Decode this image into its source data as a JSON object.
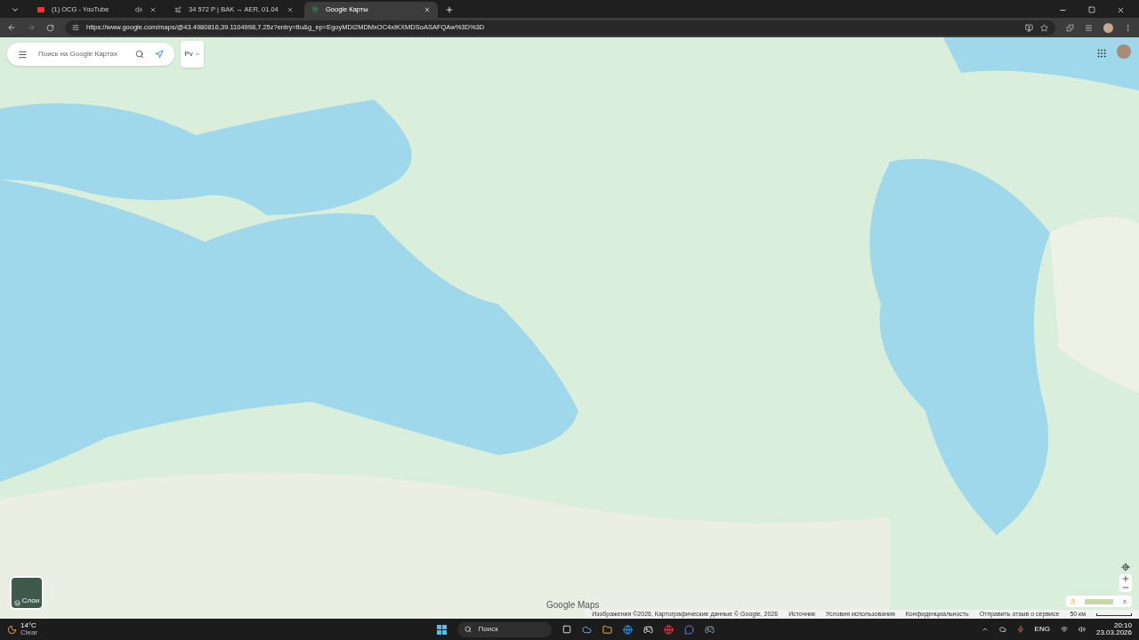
{
  "tabs": [
    {
      "title": "(1) OCG - YouTube",
      "selected": false,
      "playing_audio": true
    },
    {
      "title": "34 572 Р | BAK → AER, 01.04",
      "selected": false,
      "playing_audio": false
    },
    {
      "title": "Google Карты",
      "selected": true,
      "playing_audio": false
    }
  ],
  "address_bar": {
    "url": "https://www.google.com/maps/@43.4980816,39.1104998,7.25z?entry=ttu&g_ep=EgoyMDI2MDMxOC4xIKXMDSoASAFQAw%3D%3D"
  },
  "maps": {
    "search": {
      "placeholder": "Поиск на Google Картах"
    },
    "chip": "Рv",
    "layers_label": "Слои",
    "logo": "Google Maps",
    "footer": [
      "Изображения ©2026, Картографические данные © Google, 2026",
      "Источник",
      "Условия использования",
      "Конфиденциальность",
      "Отправить отзыв о сервисе"
    ],
    "scale": "50 км"
  },
  "taskbar": {
    "temperature": "14°C",
    "condition": "Clear",
    "search_placeholder": "Поиск",
    "language": "ENG",
    "time": "20:10",
    "date": "23.03.2026"
  }
}
